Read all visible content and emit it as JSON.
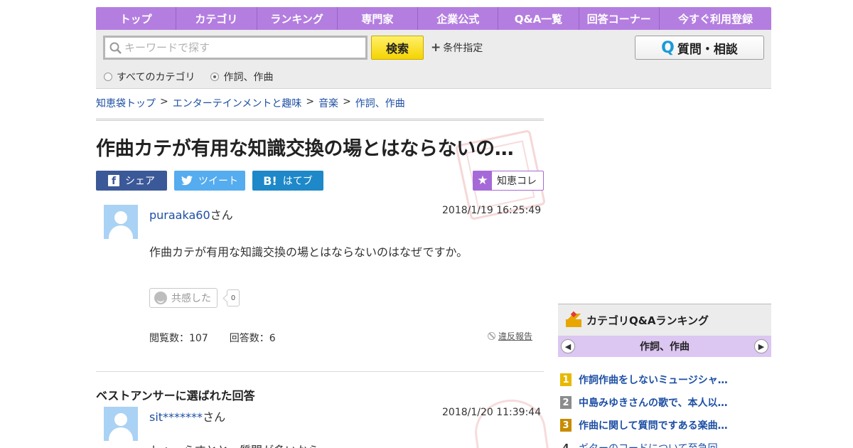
{
  "nav": {
    "items": [
      "トップ",
      "カテゴリ",
      "ランキング",
      "専門家",
      "企業公式",
      "Q&A一覧",
      "回答コーナー",
      "今すぐ利用登録"
    ]
  },
  "search": {
    "placeholder": "キーワードで探す",
    "button_label": "検索",
    "conditions_label": "条件指定",
    "ask_label": "質問・相談",
    "radio_all": "すべてのカテゴリ",
    "radio_current": "作詞、作曲",
    "selected": "作詞、作曲"
  },
  "breadcrumb": [
    "知恵袋トップ",
    "エンターテインメントと趣味",
    "音楽",
    "作詞、作曲"
  ],
  "question": {
    "title": "作曲カテが有用な知識交換の場とはならないの…",
    "user": "puraaka60",
    "honorific": "さん",
    "timestamp": "2018/1/19  16:25:49",
    "body": "作曲カテが有用な知識交換の場とはならないのはなぜですか。",
    "empathy_label": "共感した",
    "empathy_count": "0",
    "views": "閲覧数：107",
    "answers": "回答数：6",
    "report_label": "違反報告"
  },
  "share": {
    "facebook": "シェア",
    "twitter": "ツイート",
    "hatena": "はてブ",
    "chiekore": "知恵コレ"
  },
  "best_answer": {
    "heading": "ベストアンサーに選ばれた回答",
    "user": "sit*******",
    "honorific": "さん",
    "timestamp": "2018/1/20  11:39:44",
    "body": "トゥーらすとと、質問が多いから"
  },
  "ranking": {
    "title": "カテゴリQ&Aランキング",
    "category": "作詞、作曲",
    "items": [
      {
        "rank": "1",
        "text": "作詞作曲をしないミュージシャ…",
        "color": "#e8b800"
      },
      {
        "rank": "2",
        "text": "中島みゆきさんの歌で、本人以…",
        "color": "#8c8c8c"
      },
      {
        "rank": "3",
        "text": "作曲に関して質問ですある楽曲…",
        "color": "#c98b00"
      },
      {
        "rank": "4",
        "text": "ギターのコードについて至急回…",
        "color": ""
      }
    ]
  },
  "colors": {
    "nav_purple": "#b47ee0",
    "link_blue": "#1d4fa4",
    "facebook": "#3b5998",
    "twitter": "#55acee",
    "hatena": "#1e88c8"
  }
}
